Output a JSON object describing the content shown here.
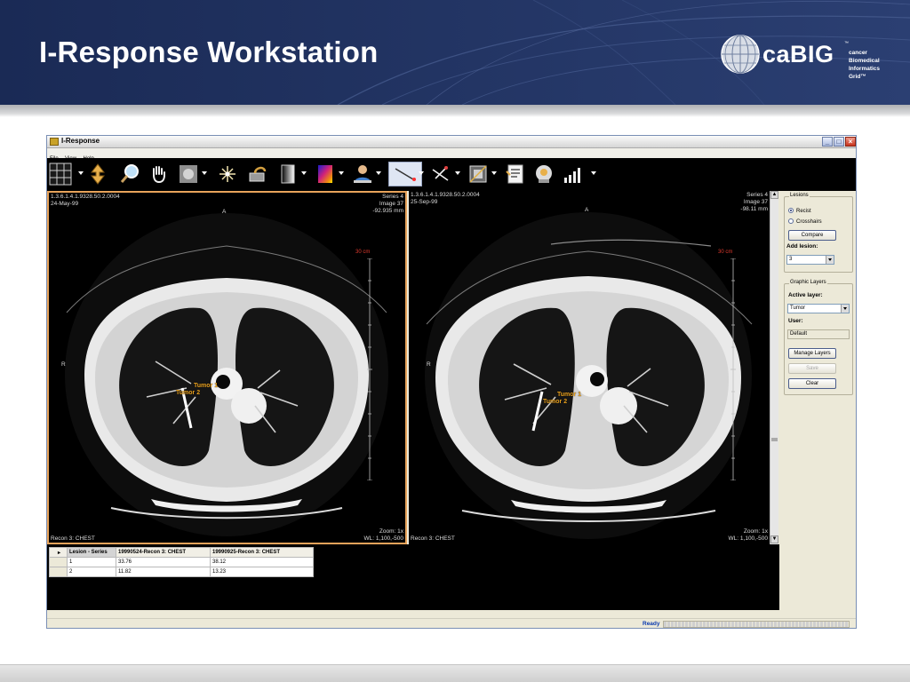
{
  "slide": {
    "title": "I-Response Workstation",
    "logo": {
      "word": "caBIG",
      "tm": "™",
      "subtitle": "cancer Biomedical\nInformatics Grid™"
    }
  },
  "window": {
    "title": "I-Response",
    "controls": {
      "minimize": "_",
      "maximize": "□",
      "close": "×"
    }
  },
  "menu": [
    "File",
    "View",
    "Help"
  ],
  "toolbar": [
    {
      "name": "layout-grid-icon",
      "dropdown": true
    },
    {
      "name": "scroll-slices-icon",
      "dropdown": false
    },
    {
      "name": "magnifier-icon",
      "dropdown": false
    },
    {
      "name": "pan-hand-icon",
      "dropdown": false
    },
    {
      "name": "thumbnail-icon",
      "dropdown": true
    },
    {
      "name": "sparkle-icon",
      "dropdown": false
    },
    {
      "name": "windowing-icon",
      "dropdown": false
    },
    {
      "name": "grayscale-icon",
      "dropdown": true
    },
    {
      "name": "color-map-icon",
      "dropdown": true
    },
    {
      "name": "person-icon",
      "dropdown": true
    },
    {
      "name": "ruler-tool-icon",
      "dropdown": true
    },
    {
      "name": "caliper-icon",
      "dropdown": true
    },
    {
      "name": "crop-icon",
      "dropdown": true
    },
    {
      "name": "report-icon",
      "dropdown": false
    },
    {
      "name": "head-scan-icon",
      "dropdown": false
    },
    {
      "name": "signal-bars-icon",
      "dropdown": true
    }
  ],
  "viewports": {
    "left": {
      "uid": "1.3.6.1.4.1.9328.50.2.0004",
      "date": "24-May-99",
      "series": "Series 4",
      "image": "Image 37",
      "position": "-92.935 mm",
      "orient_top": "A",
      "orient_left": "R",
      "scale": "30 cm",
      "zoom": "Zoom: 1x",
      "wl": "WL: 1,100,-500",
      "recon": "Recon 3: CHEST",
      "tumors": [
        "Tumor 1",
        "Tumor 2"
      ]
    },
    "right": {
      "uid": "1.3.6.1.4.1.9328.50.2.0004",
      "date": "25-Sep-99",
      "series": "Series 4",
      "image": "Image 37",
      "position": "-98.11 mm",
      "orient_top": "A",
      "orient_left": "R",
      "scale": "30 cm",
      "zoom": "Zoom: 1x",
      "wl": "WL: 1,100,-500",
      "recon": "Recon 3: CHEST",
      "tumors": [
        "Tumor 1",
        "Tumor 2"
      ]
    }
  },
  "panel": {
    "lesions": {
      "title": "Lesions",
      "radio_recist": "Recist",
      "radio_crosshairs": "Crosshairs",
      "compare": "Compare",
      "add_lesion_label": "Add lesion:",
      "add_lesion_value": "3"
    },
    "layers": {
      "title": "Graphic Layers",
      "active_label": "Active layer:",
      "active_value": "Tumor",
      "user_label": "User:",
      "user_value": "Default",
      "manage": "Manage Layers",
      "save": "Save",
      "clear": "Clear"
    }
  },
  "grid": {
    "headers": [
      "Lesion - Series",
      "19990524-Recon 3: CHEST",
      "19990925-Recon 3: CHEST"
    ],
    "rows": [
      [
        "1",
        "33.76",
        "38.12"
      ],
      [
        "2",
        "11.82",
        "13.23"
      ]
    ]
  },
  "status": {
    "text": "Ready"
  }
}
